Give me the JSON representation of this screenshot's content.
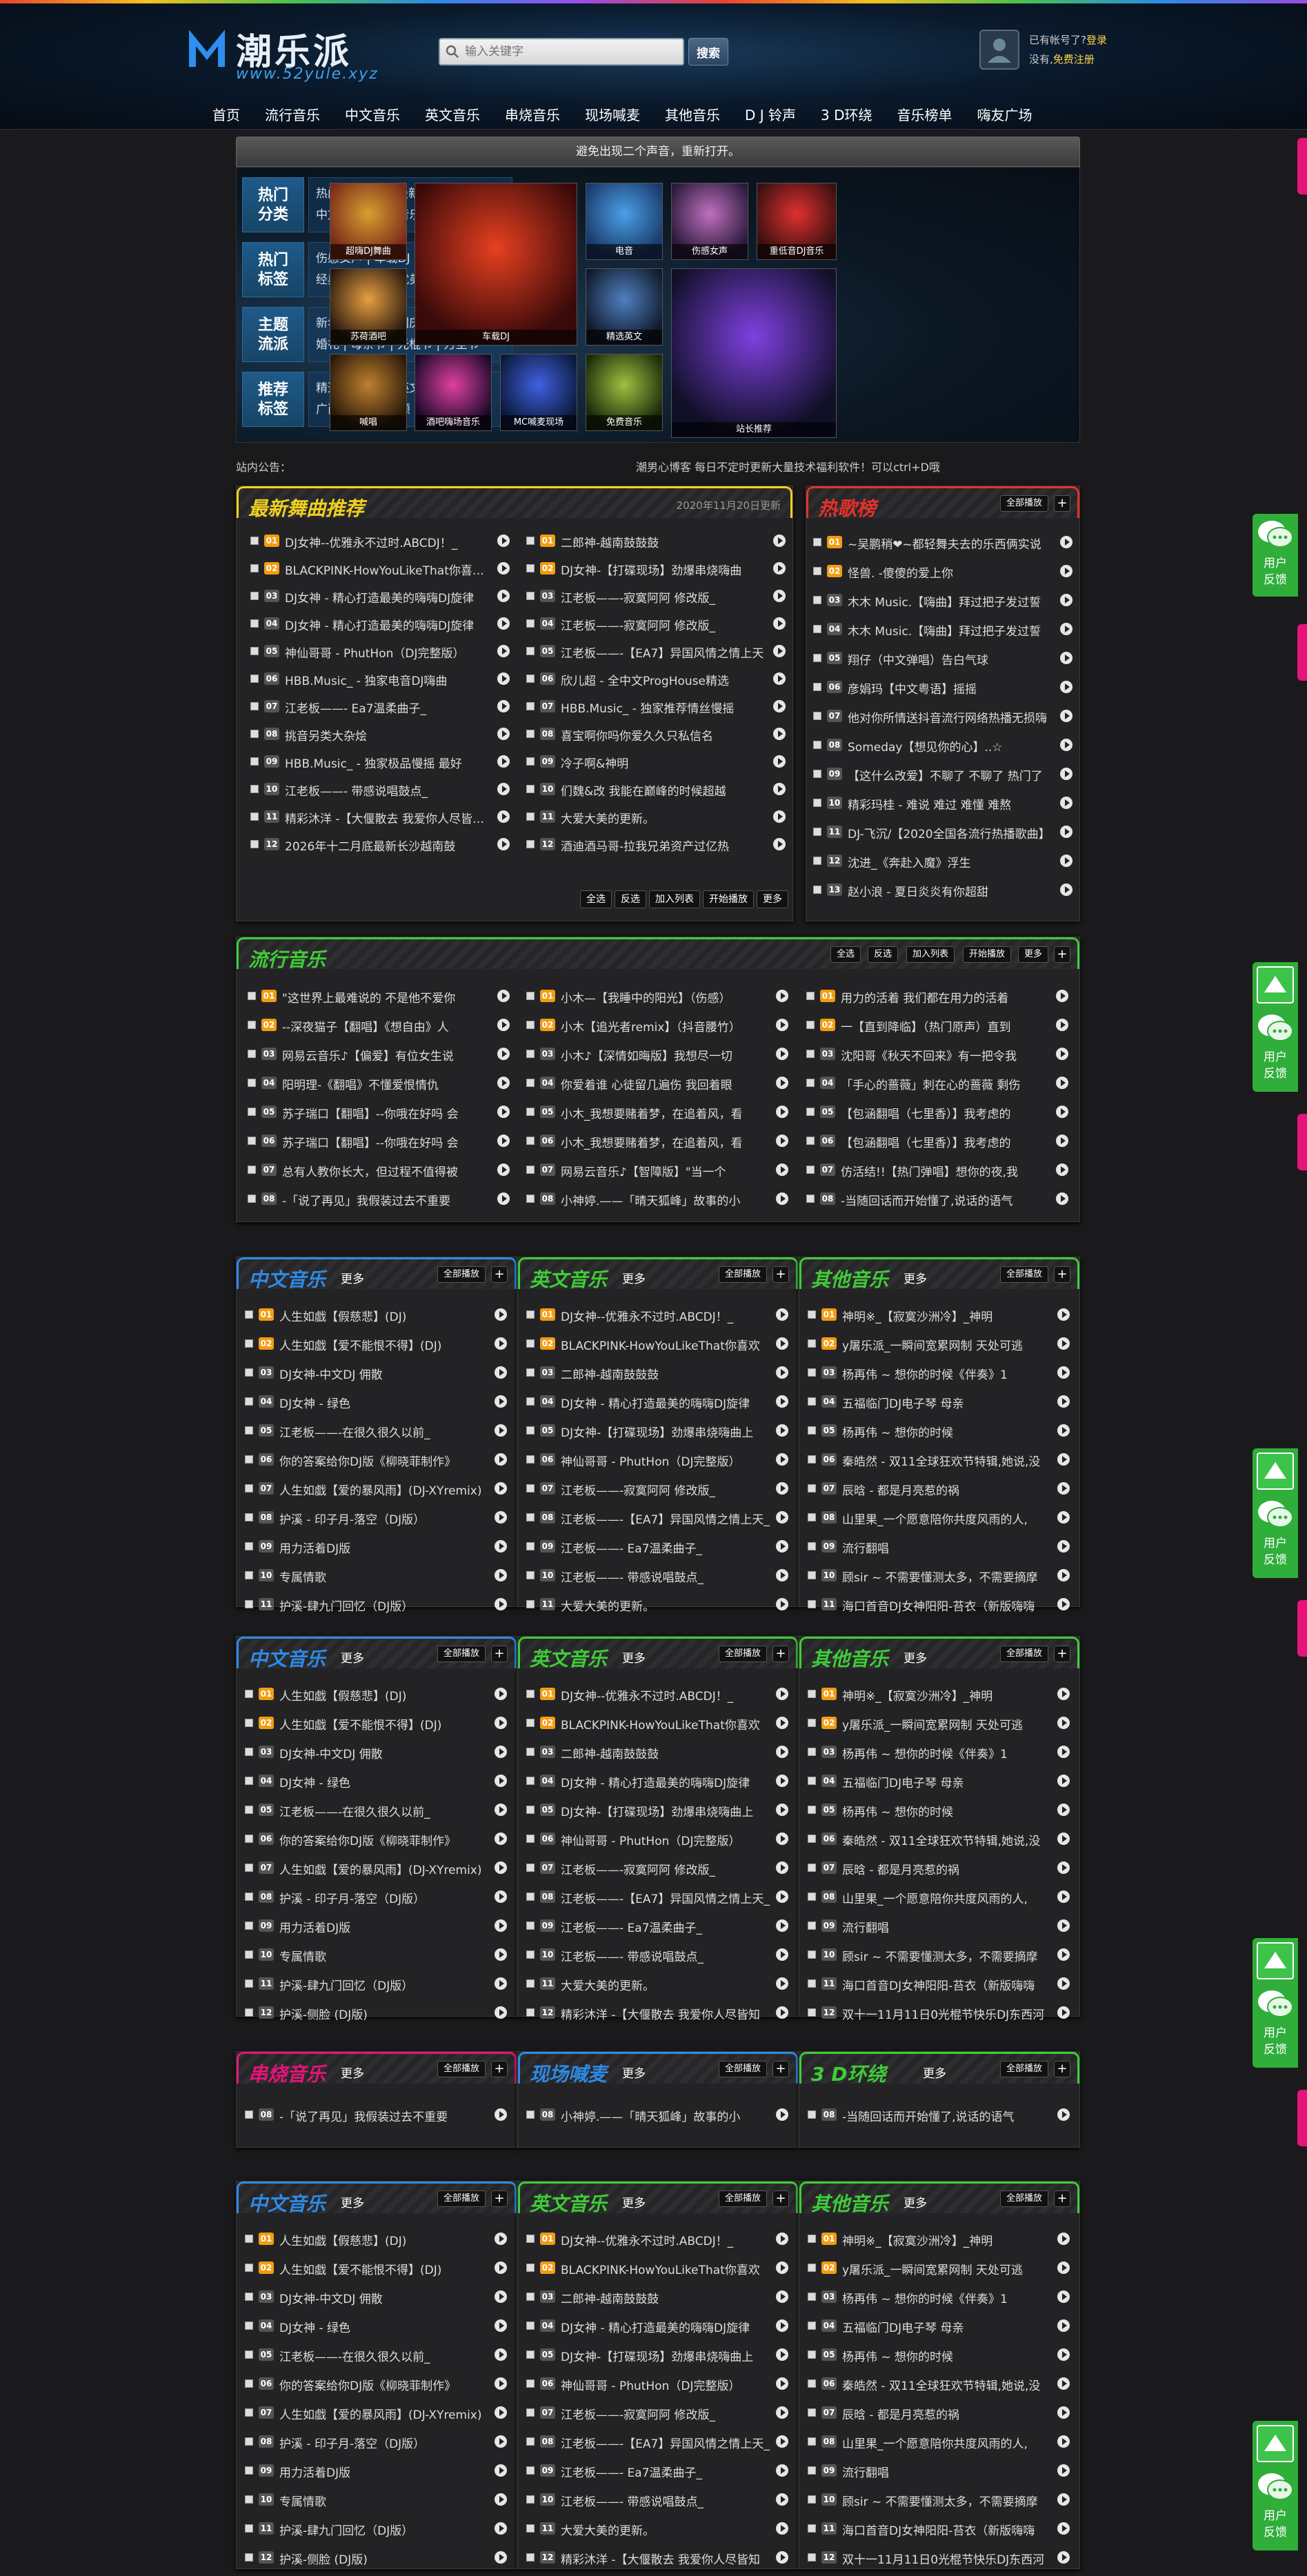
{
  "site": {
    "title": "潮乐派",
    "url": "www.52yule.xyz"
  },
  "search": {
    "placeholder": "输入关键字",
    "button": "搜索"
  },
  "user": {
    "line1_prefix": "已有帐号了?",
    "login": "登录",
    "line2_prefix": "没有,",
    "register": "免费注册"
  },
  "nav": [
    "首页",
    "流行音乐",
    "中文音乐",
    "英文音乐",
    "串烧音乐",
    "现场喊麦",
    "其他音乐",
    "D J 铃声",
    "3 D环绕",
    "音乐榜单",
    "嗨友广场"
  ],
  "tip": "避免出现二个声音，重新打开。",
  "categories": [
    {
      "label": [
        "热门",
        "分类"
      ],
      "lines": [
        "热门TOP500 | 最新音乐TOP100",
        "中文音乐 | 串烧音乐 | 英文音乐"
      ]
    },
    {
      "label": [
        "热门",
        "标签"
      ],
      "lines": [
        "伤感女声 | 车载DJ | 超嗨DJ | 铃声",
        "经典回顾 | 旋律优美 | 重低音DJ"
      ]
    },
    {
      "label": [
        "主题",
        "流派"
      ],
      "lines": [
        "新年 | 情人节 | 国庆 | 六一儿童节",
        "婚礼 | 母亲节 | 光棍节 | 万圣节"
      ]
    },
    {
      "label": [
        "推荐",
        "标签"
      ],
      "lines": [
        "精选中文 | 精选英文 | 网络云",
        "广西DJ | 经典回顾 | 世界杯"
      ]
    }
  ],
  "thumbs": [
    "超嗨DJ舞曲",
    "车载DJ",
    "电音",
    "伤感女声",
    "重低音DJ音乐",
    "苏荷酒吧",
    "精选英文",
    "喊唱",
    "酒吧嗨场音乐",
    "MC喊麦现场",
    "免费音乐",
    "站长推荐"
  ],
  "notice": {
    "label": "站内公告：",
    "text": "潮男心博客 每日不定时更新大量技术福利软件！可以ctrl+D哦"
  },
  "colors": {
    "yellow": "#f0d020",
    "red": "#e8302a",
    "green": "#3fcc38",
    "blue": "#2e8ae6",
    "pink": "#e8137a"
  },
  "new_panel": {
    "title": "最新舞曲推荐",
    "date": "2020年11月20日更新",
    "buttons": [
      "全选",
      "反选",
      "加入列表",
      "开始播放",
      "更多"
    ],
    "col1": [
      "DJ女神--优雅永不过时.ABCDJ！_",
      "BLACKPINK-HowYouLikeThat你喜欢吗",
      "DJ女神 - 精心打造最美的嗨嗨DJ旋律",
      "DJ女神 - 精心打造最美的嗨嗨DJ旋律",
      "神仙哥哥 - PhutHon（DJ完整版）",
      "HBB.Music_ - 独家电音DJ嗨曲",
      "江老板——- Ea7温柔曲子_",
      "挑音另类大杂烩",
      "HBB.Music_ - 独家极品慢摇 最好",
      "江老板——- 带感说唱鼓点_",
      "精彩沐洋 -【大偃散去 我爱你人尽皆知】",
      "2026年十二月底最新长沙越南鼓"
    ],
    "col2": [
      "二郎神-越南鼓鼓鼓",
      "DJ女神-【打碟现场】劲爆串烧嗨曲",
      "江老板——-寂寞阿阿 修改版_",
      "江老板——-寂寞阿阿 修改版_",
      "江老板——-【EA7】异国风情之情上天",
      "欣儿超 - 全中文ProgHouse精选",
      "HBB.Music_ - 独家推荐情丝慢摇",
      "喜宝啊你吗你爱久久只私信名",
      "冷子啊&神明",
      "们魏&改 我能在巅峰的时候超越",
      "大爱大美的更新。",
      "酒迪酒马哥-拉我兄弟资产过亿热"
    ]
  },
  "hot_panel": {
    "title": "热歌榜",
    "buttons": [
      "全部播放"
    ],
    "rows": [
      "~吴鹏稍❤~都轻舞夫去的乐西俩实说",
      "怪兽. -傻傻的爱上你",
      "木木 Music.【嗨曲】拜过把子发过誓",
      "木木 Music.【嗨曲】拜过把子发过誓",
      "翔仔（中文弹唱）告白气球",
      "彦娟玛【中文粤语】摇摇",
      "他对你所情送抖音流行网络热播无损嗨",
      "Someday【想见你的心】..☆",
      "【这什么改爱】不聊了 不聊了 热门了",
      "精彩玛桂 - 难说 难过 难懂 难熬",
      "DJ-飞沉/【2020全国各流行热播歌曲】",
      "沈进_《奔赴入魔》浮生",
      "赵小浪 - 夏日炎炎有你超甜"
    ]
  },
  "pop_panel": {
    "title": "流行音乐",
    "buttons": [
      "全选",
      "反选",
      "加入列表",
      "开始播放",
      "更多"
    ],
    "col1": [
      "\"这世界上最难说的 不是他不爱你",
      "--深夜猫子【翻唱】《想自由》人",
      "网易云音乐♪【偏爱】有位女生说",
      "阳明理-《翻唱》不懂爱恨情仇",
      "苏子瑞口【翻唱】--你哦在好吗 会",
      "苏子瑞口【翻唱】--你哦在好吗 会",
      "总有人教你长大，但过程不值得被",
      "-「说了再见」我假装过去不重要"
    ],
    "col2": [
      "小木—【我睡中的阳光】（伤感）",
      "小木【追光者remix】（抖音腰竹）",
      "小木♪【深情如晦版】我想尽一切",
      "你爱着谁 心徒留几遍伤 我回着眼",
      "小木_我想要赌着梦，在追着风，看",
      "小木_我想要赌着梦，在追着风，看",
      "网易云音乐♪【智障版】\"当一个",
      "小神婷.——「晴天狐峰」故事的小"
    ],
    "col3": [
      "用力的活着 我们都在用力的活着",
      "一【直到降临】（热门原声）直到",
      "沈阳哥《秋天不回来》有一把令我",
      "「手心的蔷薇」刺在心的蔷薇 剩伤",
      "【包涵翻唱（七里香）】我考虑的",
      "【包涵翻唱（七里香）】我考虑的",
      "仿活结!!【热门弹唱】想你的夜,我",
      "-当随回话而开始懂了,说话的语气"
    ]
  },
  "cn_col": [
    "人生如戯【假慈悲】(DJ)",
    "人生如戯【爱不能恨不得】(DJ)",
    "DJ女神-中文DJ 佣散",
    "DJ女神 - 绿色",
    "江老板——-在很久很久以前_",
    "你的答案给你DJ版《柳晓菲制作》",
    "人生如戯【爱的暴风雨】(DJ-XYremix)",
    "护溪 - 印子月-落空（DJ版）",
    "用力活着DJ版",
    "专属情歌",
    "护溪-肆九门回忆（DJ版）",
    "护溪-侧脸 (DJ版)"
  ],
  "en_col": [
    "DJ女神--优雅永不过时.ABCDJ！_",
    "BLACKPINK-HowYouLikeThat你喜欢",
    "二郎神-越南鼓鼓鼓",
    "DJ女神 - 精心打造最美的嗨嗨DJ旋律",
    "DJ女神-【打碟现场】劲爆串烧嗨曲上",
    "神仙哥哥 - PhutHon（DJ完整版）",
    "江老板——-寂寞阿阿 修改版_",
    "江老板——-【EA7】异国风情之情上天_",
    "江老板——- Ea7温柔曲子_",
    "江老板——- 带感说唱鼓点_",
    "大爱大美的更新。",
    "精彩沐洋 -【大偃散去 我爱你人尽皆知"
  ],
  "other_col": [
    "神明※_【寂寞沙洲冷】_神明",
    "y屠乐派_一瞬间宽累网制 天处可逃",
    "杨再伟 ~ 想你的时候《伴奏》1",
    "五福临门DJ电子琴 母亲",
    "杨再伟 ~ 想你的时候",
    "秦皓然 - 双11全球狂欢节特辑,她说,没",
    "辰晗 - 都是月亮惹的祸",
    "山里果_一个愿意陪你共度风雨的人,",
    "流行翻唱",
    "顾sir ~ 不需要懂测太多，不需要摘摩",
    "海口首音DJ女神阳阳-苔衣（新版嗨嗨",
    "双十一11月11日0光棍节快乐DJ东西河"
  ],
  "group_titles": {
    "cn": "中文音乐",
    "en": "英文音乐",
    "other": "其他音乐",
    "chuan": "串烧音乐",
    "live": "现场喊麦",
    "three": "3 D环绕",
    "more": "更多",
    "play_all": "全部播放"
  },
  "small_rows": {
    "chuan": "-「说了再见」我假装过去不重要",
    "live": "小神婷.——「晴天狐峰」故事的小",
    "three": "-当随回话而开始懂了,说话的语气"
  },
  "feedback": {
    "label": [
      "用户",
      "反馈"
    ]
  }
}
